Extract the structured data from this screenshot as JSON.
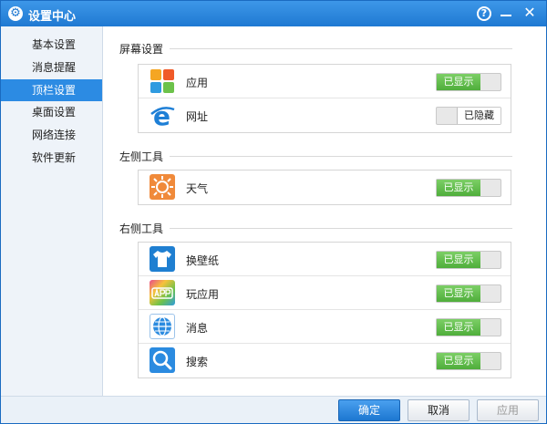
{
  "window": {
    "title": "设置中心"
  },
  "sidebar": {
    "items": [
      {
        "label": "基本设置"
      },
      {
        "label": "消息提醒"
      },
      {
        "label": "顶栏设置"
      },
      {
        "label": "桌面设置"
      },
      {
        "label": "网络连接"
      },
      {
        "label": "软件更新"
      }
    ],
    "active": "顶栏设置"
  },
  "sections": {
    "screen": {
      "title": "屏幕设置",
      "rows": [
        {
          "label": "应用",
          "state": "已显示",
          "icon": "apps-grid-icon"
        },
        {
          "label": "网址",
          "state": "已隐藏",
          "icon": "browser-e-icon"
        }
      ]
    },
    "left_tools": {
      "title": "左侧工具",
      "rows": [
        {
          "label": "天气",
          "state": "已显示",
          "icon": "sun-icon"
        }
      ]
    },
    "right_tools": {
      "title": "右侧工具",
      "rows": [
        {
          "label": "换壁纸",
          "state": "已显示",
          "icon": "tshirt-icon"
        },
        {
          "label": "玩应用",
          "state": "已显示",
          "icon": "app-badge-icon"
        },
        {
          "label": "消息",
          "state": "已显示",
          "icon": "globe-message-icon"
        },
        {
          "label": "搜索",
          "state": "已显示",
          "icon": "magnifier-icon"
        }
      ]
    }
  },
  "footer": {
    "ok_label": "确定",
    "cancel_label": "取消",
    "apply_label": "应用"
  },
  "colors": {
    "titlebar": "#2a86dd",
    "accent": "#2c8be3",
    "toggle_on": "#5cba47"
  }
}
